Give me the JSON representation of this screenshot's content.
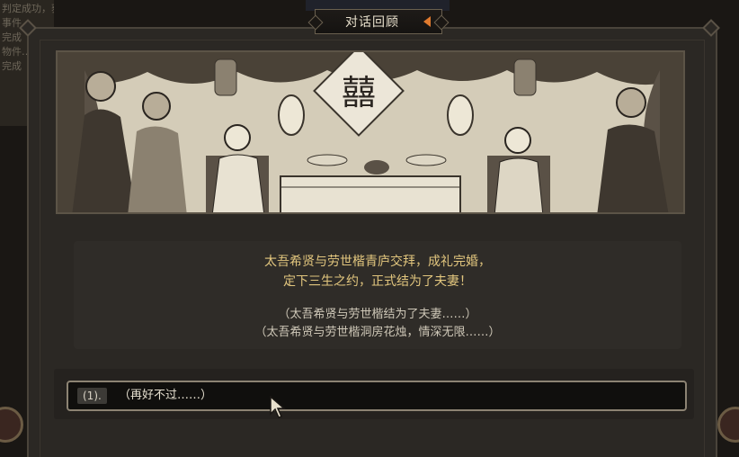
{
  "background_text": [
    "判定成功，获得了奖励",
    "事件…",
    "完成",
    "物件…",
    "完成"
  ],
  "dialog": {
    "title": "对话回顾",
    "back_icon": "orange-left-triangle"
  },
  "illustration": {
    "banner_text": "囍"
  },
  "narration": {
    "line1": "太吾希贤与劳世楷青庐交拜，成礼完婚，",
    "line2": "定下三生之约，正式结为了夫妻！",
    "line3": "（太吾希贤与劳世楷结为了夫妻……）",
    "line4": "（太吾希贤与劳世楷洞房花烛，情深无限……）"
  },
  "choices": [
    {
      "num": "(1).",
      "label": "（再好不过……）"
    }
  ],
  "colors": {
    "accent_orange": "#e07a2e",
    "narration_gold": "#e2c67e"
  }
}
